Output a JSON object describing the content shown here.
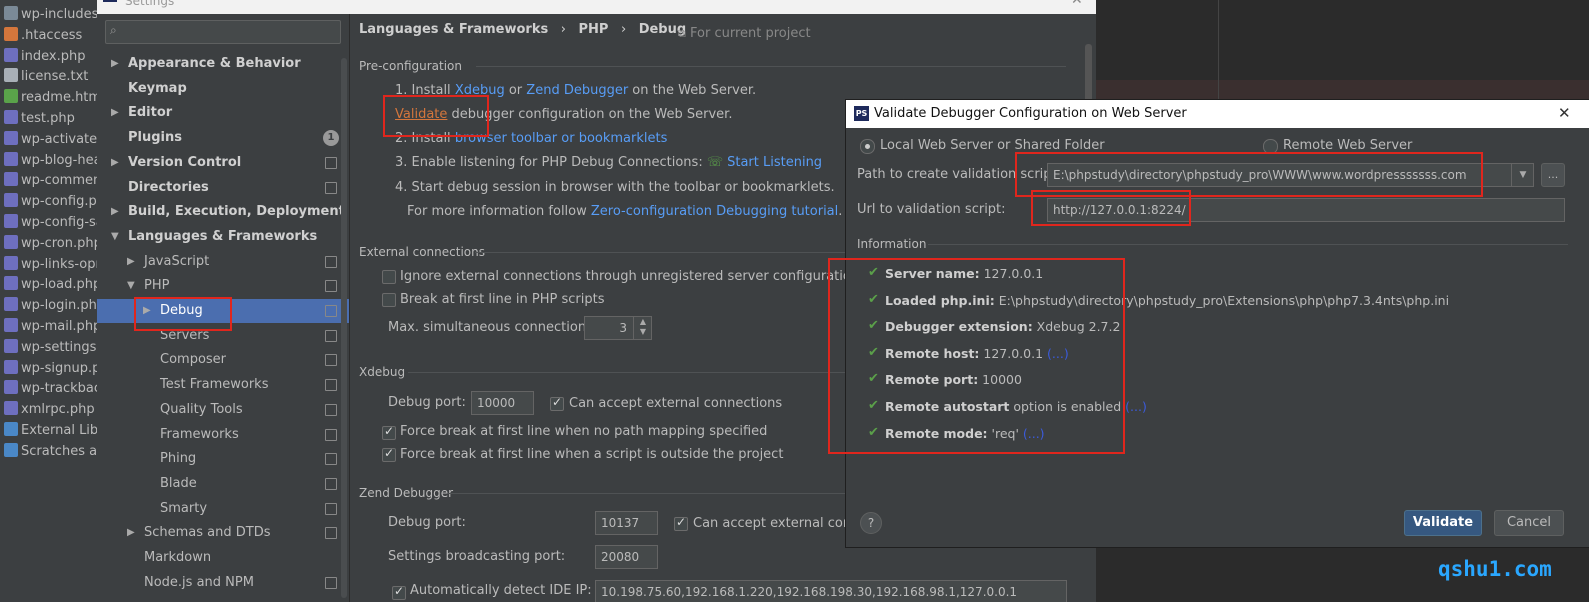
{
  "project_tree": [
    {
      "label": "wp-includes",
      "icon": "folder-icon"
    },
    {
      "label": ".htaccess",
      "icon": "htaccess-icon"
    },
    {
      "label": "index.php",
      "icon": "php-file-icon"
    },
    {
      "label": "license.txt",
      "icon": "text-file-icon"
    },
    {
      "label": "readme.html",
      "icon": "html-file-icon"
    },
    {
      "label": "test.php",
      "icon": "php-file-icon"
    },
    {
      "label": "wp-activate.p",
      "icon": "php-file-icon"
    },
    {
      "label": "wp-blog-hea",
      "icon": "php-file-icon"
    },
    {
      "label": "wp-commen",
      "icon": "php-file-icon"
    },
    {
      "label": "wp-config.ph",
      "icon": "php-file-icon"
    },
    {
      "label": "wp-config-sa",
      "icon": "php-file-icon"
    },
    {
      "label": "wp-cron.php",
      "icon": "php-file-icon"
    },
    {
      "label": "wp-links-opr",
      "icon": "php-file-icon"
    },
    {
      "label": "wp-load.php",
      "icon": "php-file-icon"
    },
    {
      "label": "wp-login.php",
      "icon": "php-file-icon"
    },
    {
      "label": "wp-mail.php",
      "icon": "php-file-icon"
    },
    {
      "label": "wp-settings.p",
      "icon": "php-file-icon"
    },
    {
      "label": "wp-signup.pl",
      "icon": "php-file-icon"
    },
    {
      "label": "wp-trackbacl",
      "icon": "php-file-icon"
    },
    {
      "label": "xmlrpc.php",
      "icon": "php-file-icon"
    },
    {
      "label": "External Librarie",
      "icon": "library-icon"
    },
    {
      "label": "Scratches and C",
      "icon": "scratches-icon"
    }
  ],
  "settings": {
    "title": "Settings",
    "search_placeholder": "",
    "tree": [
      {
        "label": "Appearance & Behavior",
        "level": 0,
        "bold": true,
        "arrow": "▶"
      },
      {
        "label": "Keymap",
        "level": 0,
        "bold": true,
        "arrow": ""
      },
      {
        "label": "Editor",
        "level": 0,
        "bold": true,
        "arrow": "▶"
      },
      {
        "label": "Plugins",
        "level": 0,
        "bold": true,
        "arrow": "",
        "badge": "1"
      },
      {
        "label": "Version Control",
        "level": 0,
        "bold": true,
        "arrow": "▶",
        "copy": true
      },
      {
        "label": "Directories",
        "level": 0,
        "bold": true,
        "arrow": "",
        "copy": true
      },
      {
        "label": "Build, Execution, Deployment",
        "level": 0,
        "bold": true,
        "arrow": "▶"
      },
      {
        "label": "Languages & Frameworks",
        "level": 0,
        "bold": true,
        "arrow": "▼"
      },
      {
        "label": "JavaScript",
        "level": 1,
        "arrow": "▶",
        "copy": true
      },
      {
        "label": "PHP",
        "level": 1,
        "arrow": "▼",
        "copy": true
      },
      {
        "label": "Debug",
        "level": 2,
        "arrow": "▶",
        "copy": true,
        "selected": true
      },
      {
        "label": "Servers",
        "level": 2,
        "arrow": "",
        "copy": true
      },
      {
        "label": "Composer",
        "level": 2,
        "arrow": "",
        "copy": true
      },
      {
        "label": "Test Frameworks",
        "level": 2,
        "arrow": "",
        "copy": true
      },
      {
        "label": "Quality Tools",
        "level": 2,
        "arrow": "",
        "copy": true
      },
      {
        "label": "Frameworks",
        "level": 2,
        "arrow": "",
        "copy": true
      },
      {
        "label": "Phing",
        "level": 2,
        "arrow": "",
        "copy": true
      },
      {
        "label": "Blade",
        "level": 2,
        "arrow": "",
        "copy": true
      },
      {
        "label": "Smarty",
        "level": 2,
        "arrow": "",
        "copy": true
      },
      {
        "label": "Schemas and DTDs",
        "level": 1,
        "arrow": "▶",
        "copy": true
      },
      {
        "label": "Markdown",
        "level": 1,
        "arrow": ""
      },
      {
        "label": "Node.js and NPM",
        "level": 1,
        "arrow": "",
        "copy": true
      }
    ],
    "breadcrumb": {
      "part1": "Languages & Frameworks",
      "sep": "›",
      "part2": "PHP",
      "part3": "Debug",
      "scope": "For current project"
    },
    "preconfig": {
      "heading": "Pre-configuration",
      "s1_prefix": "1. Install ",
      "s1_link1": "Xdebug",
      "s1_mid": " or ",
      "s1_link2": "Zend Debugger",
      "s1_suffix": " on the Web Server.",
      "s1b_link": "Validate",
      "s1b_suffix": " debugger configuration on the Web Server.",
      "s2_prefix": "2. Install ",
      "s2_link": "browser toolbar or bookmarklets",
      "s3_prefix": "3. Enable listening for PHP Debug Connections: ",
      "s3_link": "Start Listening",
      "s4": "4. Start debug session in browser with the toolbar or bookmarklets.",
      "s4b_prefix": "For more information follow ",
      "s4b_link": "Zero-configuration Debugging tutorial",
      "s4b_suffix": "."
    },
    "external": {
      "heading": "External connections",
      "ignore": "Ignore external connections through unregistered server configurations",
      "break_first": "Break at first line in PHP scripts",
      "max_label": "Max. simultaneous connections:",
      "max_value": "3"
    },
    "xdebug": {
      "heading": "Xdebug",
      "port_label": "Debug port:",
      "port_value": "10000",
      "accept": "Can accept external connections",
      "force1": "Force break at first line when no path mapping specified",
      "force2": "Force break at first line when a script is outside the project"
    },
    "zend": {
      "heading": "Zend Debugger",
      "port_label": "Debug port:",
      "port_value": "10137",
      "accept": "Can accept external conne",
      "bcast_label": "Settings broadcasting port:",
      "bcast_value": "20080",
      "auto_label": "Automatically detect IDE IP:",
      "ips": "10.198.75.60,192.168.1.220,192.168.198.30,192.168.98.1,127.0.0.1"
    }
  },
  "validate_dialog": {
    "title": "Validate Debugger Configuration on Web Server",
    "app_icon_text": "PS",
    "radio_local": "Local Web Server or Shared Folder",
    "radio_remote": "Remote Web Server",
    "path_label": "Path to create validation script:",
    "path_value": "E:\\phpstudy\\directory\\phpstudy_pro\\WWW\\www.wordpresssssss.com",
    "url_label": "Url to validation script:",
    "url_value": "http://127.0.0.1:8224/",
    "info_heading": "Information",
    "info": [
      {
        "key": "Server name:",
        "value": " 127.0.0.1",
        "more": ""
      },
      {
        "key": "Loaded php.ini:",
        "value": " E:\\phpstudy\\directory\\phpstudy_pro\\Extensions\\php\\php7.3.4nts\\php.ini",
        "more": ""
      },
      {
        "key": "Debugger extension:",
        "value": " Xdebug 2.7.2",
        "more": ""
      },
      {
        "key": "Remote host:",
        "value": " 127.0.0.1 ",
        "more": "(...)"
      },
      {
        "key": "Remote port:",
        "value": " 10000",
        "more": ""
      },
      {
        "key": "Remote autostart",
        "value": " option is enabled ",
        "more": "(...)"
      },
      {
        "key": "Remote mode:",
        "value": " 'req' ",
        "more": "(...)"
      }
    ],
    "help": "?",
    "validate_btn": "Validate",
    "cancel_btn": "Cancel",
    "browse_btn": "..."
  },
  "watermark": "qshu1.com",
  "colors": {
    "highlight": "#e0261d",
    "link": "#589df6",
    "selection": "#4b6eaf",
    "check": "#5ba04a"
  }
}
